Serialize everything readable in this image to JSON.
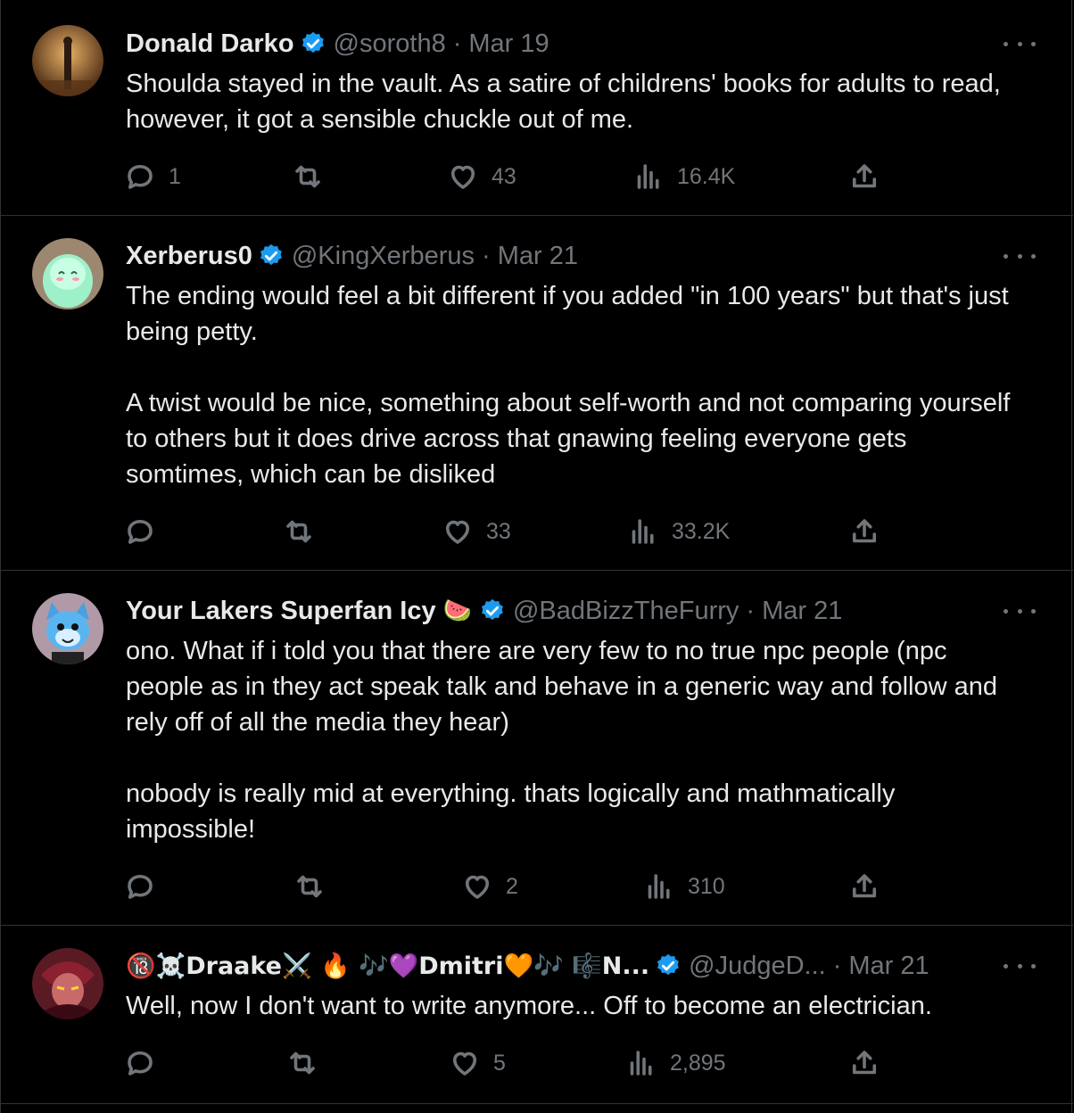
{
  "tweets": [
    {
      "name": "Donald Darko",
      "handle": "@soroth8",
      "date": "Mar 19",
      "text": "Shoulda stayed in the vault.  As a satire of childrens' books for adults to read, however, it got a sensible chuckle out of me.",
      "replies": "1",
      "retweets": "",
      "likes": "43",
      "views": "16.4K"
    },
    {
      "name": "Xerberus0",
      "handle": "@KingXerberus",
      "date": "Mar 21",
      "text": "The ending would feel a bit different if you added \"in 100 years\" but that's just being petty.\n\nA twist would be nice, something about self-worth and not comparing yourself to others but it does drive across that gnawing feeling everyone gets somtimes, which can be disliked",
      "replies": "",
      "retweets": "",
      "likes": "33",
      "views": "33.2K"
    },
    {
      "name": "Your Lakers Superfan Icy",
      "name_emoji": "🍉",
      "handle": "@BadBizzTheFurry",
      "date": "Mar 21",
      "text": "ono. What if i told you that there are very few to no true npc people (npc people as in they act speak talk and behave in a generic way and follow and rely off of all the media they hear)\n\nnobody is really mid at everything. thats logically and mathmatically impossible!",
      "replies": "",
      "retweets": "",
      "likes": "2",
      "views": "310"
    },
    {
      "name": "🔞☠️Draake⚔️ 🔥 🎶💜Dmitri🧡🎶 🎼N...",
      "handle": "@JudgeD...",
      "date": "Mar 21",
      "text": "Well, now I don't want to write anymore... Off to become an electrician.",
      "replies": "",
      "retweets": "",
      "likes": "5",
      "views": "2,895"
    }
  ],
  "colors": {
    "background": "#000000",
    "text": "#e7e9ea",
    "muted": "#71767b",
    "verified": "#1d9bf0",
    "divider": "#2f3336"
  },
  "icons": [
    "reply-icon",
    "retweet-icon",
    "like-icon",
    "views-icon",
    "share-icon",
    "verified-badge-icon",
    "more-icon"
  ]
}
